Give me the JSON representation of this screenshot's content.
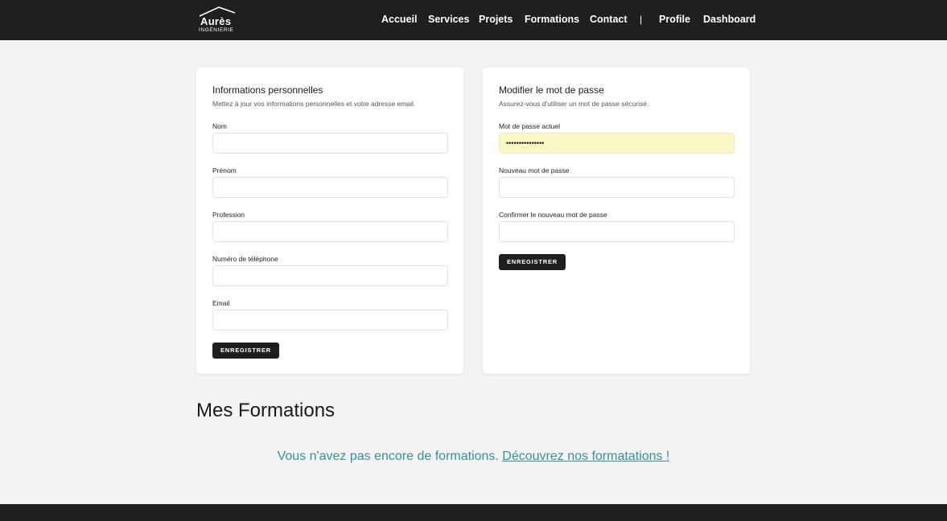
{
  "brand": {
    "name": "Aurès",
    "sub": "INGÉNIERIE"
  },
  "nav": {
    "items": [
      "Accueil",
      "Services",
      "Projets",
      "Formations",
      "Contact"
    ],
    "separator": "|",
    "profile": "Profile",
    "dashboard": "Dashboard"
  },
  "personal": {
    "title": "Informations personnelles",
    "desc": "Mettez à jour vos informations personnelles et votre adresse email.",
    "fields": [
      {
        "label": "Nom",
        "value": ""
      },
      {
        "label": "Prénom",
        "value": ""
      },
      {
        "label": "Profession",
        "value": ""
      },
      {
        "label": "Numéro de téléphone",
        "value": ""
      },
      {
        "label": "Email",
        "value": ""
      }
    ],
    "button": "ENREGISTRER"
  },
  "password": {
    "title": "Modifier le mot de passe",
    "desc": "Assurez-vous d'utiliser un mot de passe sécurisé.",
    "fields": [
      {
        "label": "Mot de passe actuel",
        "value": "•••••••••••••••"
      },
      {
        "label": "Nouveau mot de passe",
        "value": ""
      },
      {
        "label": "Confirmer le nouveau mot de passe",
        "value": ""
      }
    ],
    "button": "ENREGISTRER"
  },
  "formations": {
    "title": "Mes Formations",
    "empty_text": "Vous n'avez pas encore de formations.",
    "empty_link": "Découvrez nos formatations !"
  },
  "colors": {
    "topbar": "#1f1f1f",
    "accent": "#3b8f9a",
    "autofill": "#fbf8c5"
  }
}
